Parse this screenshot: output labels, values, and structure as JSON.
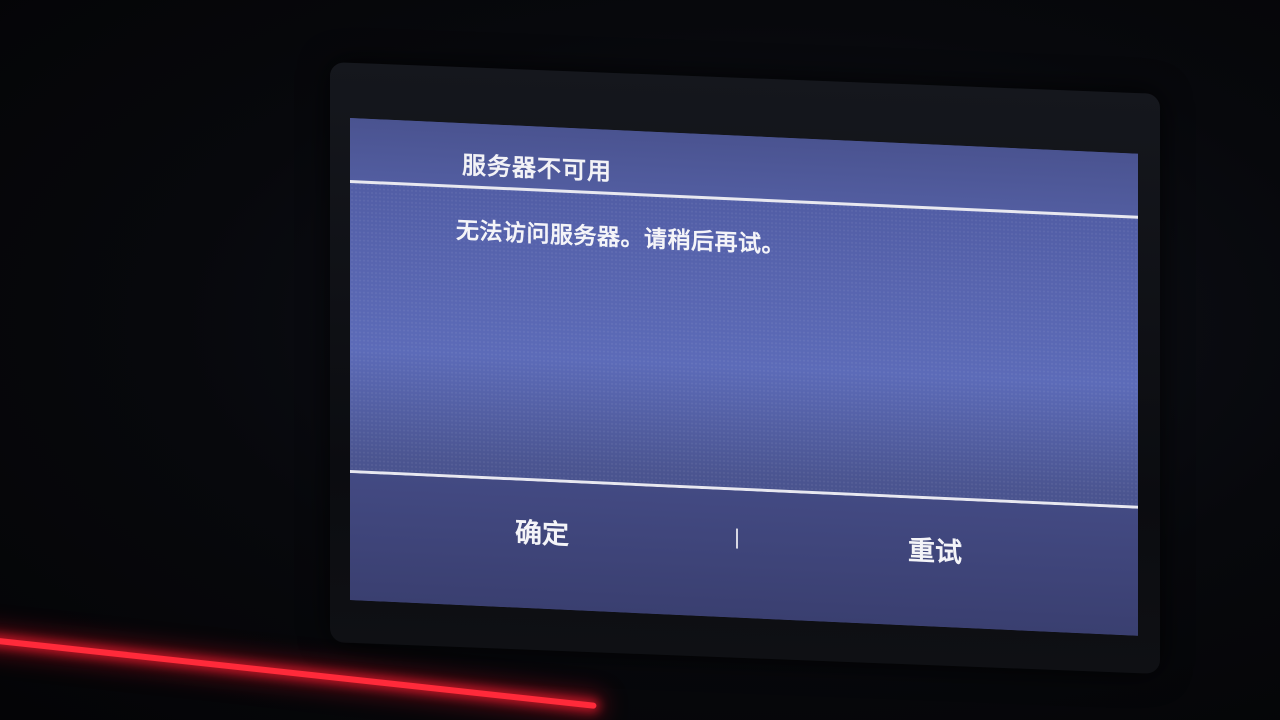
{
  "dialog": {
    "title": "服务器不可用",
    "message": "无法访问服务器。请稍后再试。",
    "buttons": {
      "ok_label": "确定",
      "retry_label": "重试"
    }
  },
  "colors": {
    "screen_background": "#5764ae",
    "text": "#f4f4f8",
    "ambient_red_light": "#ff2a3a"
  }
}
